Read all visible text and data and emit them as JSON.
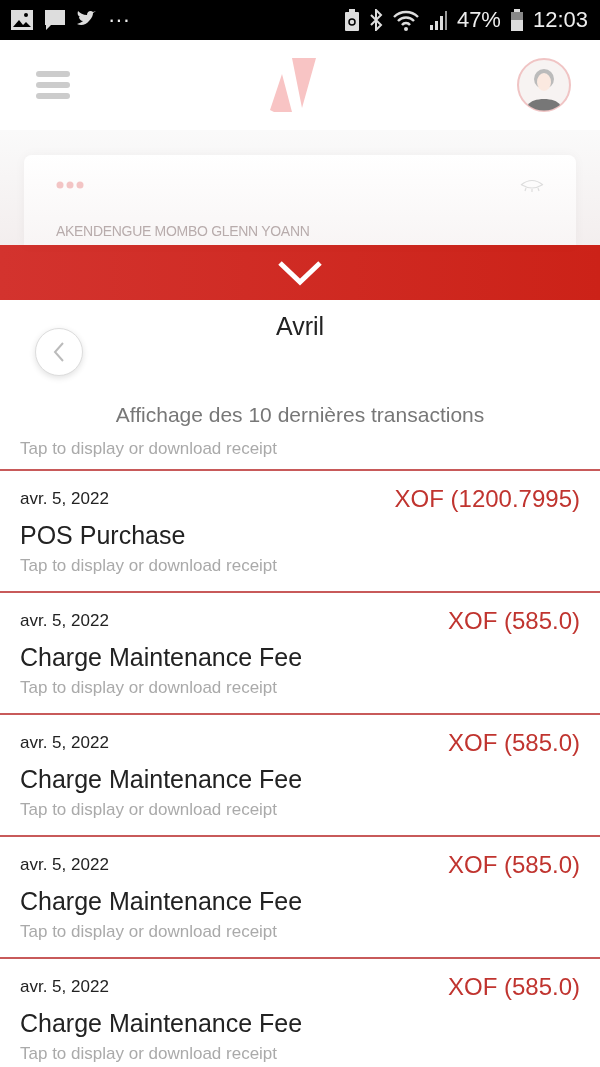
{
  "status_bar": {
    "more": "···",
    "battery_text": "47%",
    "time": "12:03"
  },
  "card": {
    "holder": "AKENDENGUE MOMBO GLENN YOANN"
  },
  "sheet": {
    "month": "Avril",
    "subtitle": "Affichage des 10 dernières transactions",
    "hint": "Tap to display or download receipt"
  },
  "transactions": [
    {
      "date": "avr. 5, 2022",
      "amount": "XOF (1200.7995)",
      "title": "POS Purchase",
      "hint": "Tap to display or download receipt"
    },
    {
      "date": "avr. 5, 2022",
      "amount": "XOF (585.0)",
      "title": "Charge Maintenance Fee",
      "hint": "Tap to display or download receipt"
    },
    {
      "date": "avr. 5, 2022",
      "amount": "XOF (585.0)",
      "title": "Charge Maintenance Fee",
      "hint": "Tap to display or download receipt"
    },
    {
      "date": "avr. 5, 2022",
      "amount": "XOF (585.0)",
      "title": "Charge Maintenance Fee",
      "hint": "Tap to display or download receipt"
    },
    {
      "date": "avr. 5, 2022",
      "amount": "XOF (585.0)",
      "title": "Charge Maintenance Fee",
      "hint": "Tap to display or download receipt"
    }
  ]
}
